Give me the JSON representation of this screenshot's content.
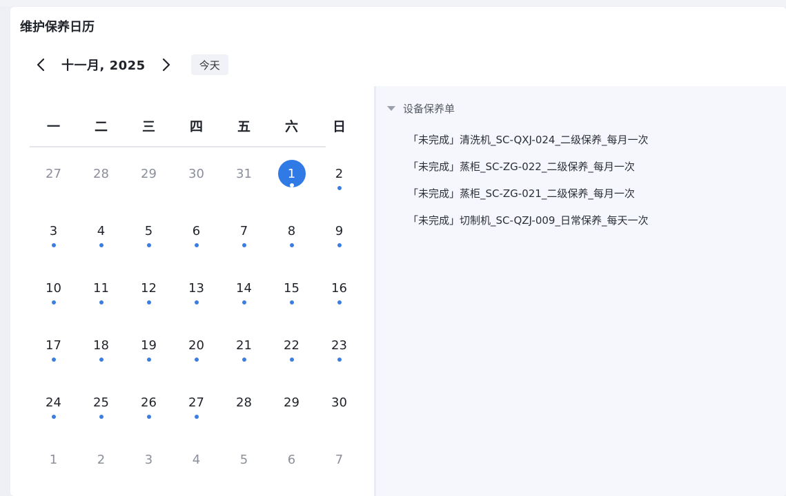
{
  "header": {
    "title": "维护保养日历"
  },
  "nav": {
    "month_label": "十一月, 2025",
    "today_label": "今天"
  },
  "weekdays": [
    "一",
    "二",
    "三",
    "四",
    "五",
    "六",
    "日"
  ],
  "weeks": [
    [
      {
        "day": "27",
        "other": true,
        "dot": false
      },
      {
        "day": "28",
        "other": true,
        "dot": false
      },
      {
        "day": "29",
        "other": true,
        "dot": false
      },
      {
        "day": "30",
        "other": true,
        "dot": false
      },
      {
        "day": "31",
        "other": true,
        "dot": false
      },
      {
        "day": "1",
        "other": false,
        "dot": true,
        "selected": true
      },
      {
        "day": "2",
        "other": false,
        "dot": true
      }
    ],
    [
      {
        "day": "3",
        "other": false,
        "dot": true
      },
      {
        "day": "4",
        "other": false,
        "dot": true
      },
      {
        "day": "5",
        "other": false,
        "dot": true
      },
      {
        "day": "6",
        "other": false,
        "dot": true
      },
      {
        "day": "7",
        "other": false,
        "dot": true
      },
      {
        "day": "8",
        "other": false,
        "dot": true
      },
      {
        "day": "9",
        "other": false,
        "dot": true
      }
    ],
    [
      {
        "day": "10",
        "other": false,
        "dot": true
      },
      {
        "day": "11",
        "other": false,
        "dot": true
      },
      {
        "day": "12",
        "other": false,
        "dot": true
      },
      {
        "day": "13",
        "other": false,
        "dot": true
      },
      {
        "day": "14",
        "other": false,
        "dot": true
      },
      {
        "day": "15",
        "other": false,
        "dot": true
      },
      {
        "day": "16",
        "other": false,
        "dot": true
      }
    ],
    [
      {
        "day": "17",
        "other": false,
        "dot": true
      },
      {
        "day": "18",
        "other": false,
        "dot": true
      },
      {
        "day": "19",
        "other": false,
        "dot": true
      },
      {
        "day": "20",
        "other": false,
        "dot": true
      },
      {
        "day": "21",
        "other": false,
        "dot": true
      },
      {
        "day": "22",
        "other": false,
        "dot": true
      },
      {
        "day": "23",
        "other": false,
        "dot": true
      }
    ],
    [
      {
        "day": "24",
        "other": false,
        "dot": true
      },
      {
        "day": "25",
        "other": false,
        "dot": true
      },
      {
        "day": "26",
        "other": false,
        "dot": true
      },
      {
        "day": "27",
        "other": false,
        "dot": true
      },
      {
        "day": "28",
        "other": false,
        "dot": false
      },
      {
        "day": "29",
        "other": false,
        "dot": false
      },
      {
        "day": "30",
        "other": false,
        "dot": false
      }
    ],
    [
      {
        "day": "1",
        "other": true,
        "dot": false
      },
      {
        "day": "2",
        "other": true,
        "dot": false
      },
      {
        "day": "3",
        "other": true,
        "dot": false
      },
      {
        "day": "4",
        "other": true,
        "dot": false
      },
      {
        "day": "5",
        "other": true,
        "dot": false
      },
      {
        "day": "6",
        "other": true,
        "dot": false
      },
      {
        "day": "7",
        "other": true,
        "dot": false
      }
    ]
  ],
  "panel": {
    "group_label": "设备保养单",
    "items": [
      "「未完成」清洗机_SC-QXJ-024_二级保养_每月一次",
      "「未完成」蒸柜_SC-ZG-022_二级保养_每月一次",
      "「未完成」蒸柜_SC-ZG-021_二级保养_每月一次",
      "「未完成」切制机_SC-QZJ-009_日常保养_每天一次"
    ]
  },
  "icons": {
    "prev": "chevron-left-icon",
    "next": "chevron-right-icon",
    "expand": "caret-down-icon"
  },
  "colors": {
    "accent": "#2f7ae5",
    "dot": "#3a7fe0",
    "panel_bg": "#f5f7fc"
  }
}
